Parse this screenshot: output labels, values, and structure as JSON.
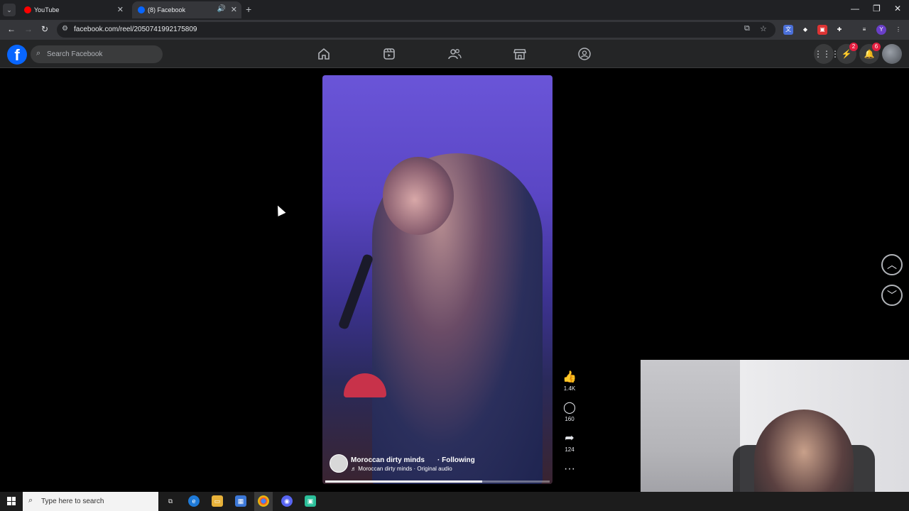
{
  "browser": {
    "tabs": [
      {
        "title": "YouTube",
        "favicon": "youtube-icon"
      },
      {
        "title": "(8) Facebook",
        "favicon": "facebook-icon",
        "active": true,
        "audio": true
      }
    ],
    "url": "facebook.com/reel/2050741992175809",
    "window_controls": [
      "minimize",
      "restore",
      "close"
    ]
  },
  "facebook": {
    "search_placeholder": "Search Facebook",
    "nav_icons": [
      "home-icon",
      "reels-icon",
      "friends-icon",
      "marketplace-icon",
      "groups-icon"
    ],
    "messenger_badge": "2",
    "notifications_badge": "6"
  },
  "reel": {
    "author": "Moroccan dirty minds",
    "follow_status": "· Following",
    "audio": "♬ Moroccan dirty minds · Original audio",
    "progress": 0.7,
    "likes": "1.4K",
    "comments": "160",
    "shares": "124"
  },
  "taskbar": {
    "search_placeholder": "Type here to search",
    "apps": [
      "task-view-icon",
      "edge-icon",
      "file-explorer-icon",
      "store-icon",
      "chrome-icon",
      "discord-icon",
      "app-icon"
    ]
  },
  "colors": {
    "facebook_blue": "#0866ff",
    "fb_header_bg": "#242526",
    "badge_red": "#e41e3f",
    "page_bg": "#000000"
  }
}
